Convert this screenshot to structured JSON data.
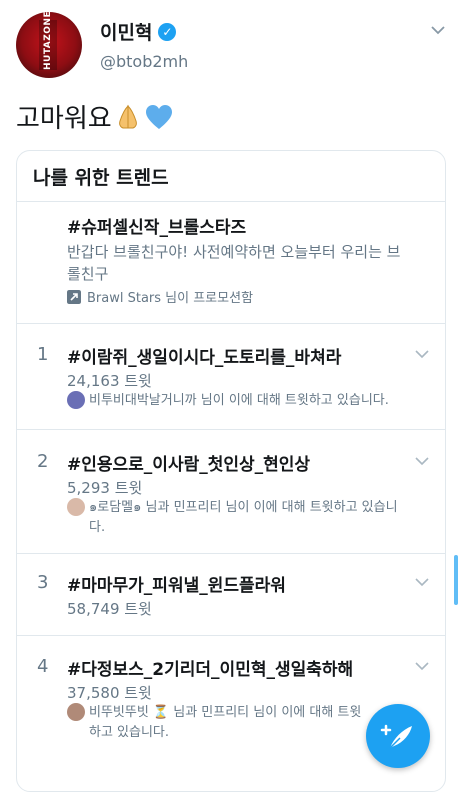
{
  "profile": {
    "name": "이민혁",
    "handle": "@btob2mh",
    "avatar_text": "HUTAZONE",
    "verified": true
  },
  "tweet": {
    "text": "고마워요",
    "emojis": [
      "folded-hands-emoji",
      "blue-heart-emoji"
    ]
  },
  "trends_card": {
    "title": "나를 위한 트렌드",
    "promoted": {
      "title": "#슈퍼셀신작_브롤스타즈",
      "description": "반갑다 브롤친구야! 사전예약하면 오늘부터 우리는 브롤친구",
      "promoter_line": "Brawl Stars 님이 프로모션함"
    },
    "items": [
      {
        "rank": "1",
        "name": "#이람쥐_생일이시다_도토리를_바쳐라",
        "count": "24,163 트윗",
        "context": "비투비대박날거니까 님이 이에 대해 트윗하고 있습니다."
      },
      {
        "rank": "2",
        "name": "#인용으로_이사람_첫인상_현인상",
        "count": "5,293 트윗",
        "context": "๑로담멜๑ 님과 민프리티 님이 이에 대해 트윗하고 있습니다."
      },
      {
        "rank": "3",
        "name": "#마마무가_피워낼_윈드플라워",
        "count": "58,749 트윗",
        "context": ""
      },
      {
        "rank": "4",
        "name": "#다정보스_2기리더_이민혁_생일축하해",
        "count": "37,580 트윗",
        "context": "비뚜빗뚜빗 ⏳ 님과 민프리티 님이 이에 대해 트윗하고 있습니다."
      }
    ]
  },
  "colors": {
    "accent": "#1da1f2",
    "text_primary": "#14171a",
    "text_secondary": "#657786",
    "border": "#e1e8ed"
  }
}
